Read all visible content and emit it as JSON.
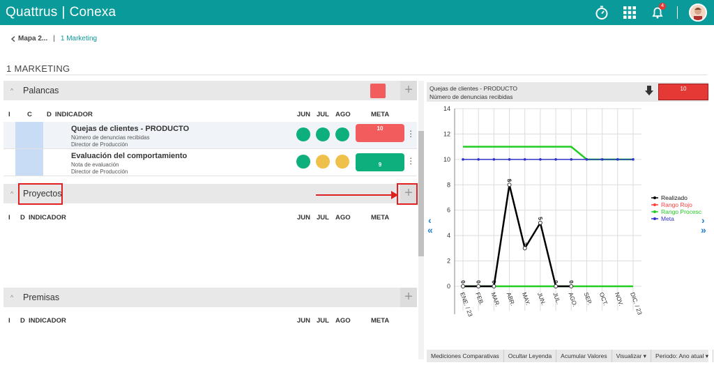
{
  "app": {
    "brand_left": "Quattrus",
    "brand_sep": "|",
    "brand_right": "Conexa",
    "notification_count": "4"
  },
  "breadcrumb": {
    "back_label": "Mapa 2...",
    "current": "1 Marketing"
  },
  "page": {
    "title": "1 MARKETING"
  },
  "palancas": {
    "label": "Palancas",
    "headers": {
      "i": "I",
      "c": "C",
      "d": "D",
      "indicador": "INDICADOR",
      "jun": "JUN",
      "jul": "JUL",
      "ago": "AGO",
      "meta": "META"
    },
    "rows": [
      {
        "name": "Quejas de clientes - PRODUCTO",
        "sub1": "Número de denuncias recibidas",
        "sub2": "Director de Producción",
        "jun": "green",
        "jul": "green",
        "ago": "green",
        "meta_value": "10",
        "meta_color": "red"
      },
      {
        "name": "Evaluación del comportamiento",
        "sub1": "Nota de evaluación",
        "sub2": "Director de Producción",
        "jun": "green",
        "jul": "yellow",
        "ago": "yellow",
        "meta_value": "9",
        "meta_color": "green"
      }
    ]
  },
  "proyectos": {
    "label": "Proyectos",
    "headers": {
      "i": "I",
      "d": "D",
      "indicador": "INDICADOR",
      "jun": "JUN",
      "jul": "JUL",
      "ago": "AGO",
      "meta": "META"
    }
  },
  "premisas": {
    "label": "Premisas",
    "headers": {
      "i": "I",
      "d": "D",
      "indicador": "INDICADOR",
      "jun": "JUN",
      "jul": "JUL",
      "ago": "AGO",
      "meta": "META"
    }
  },
  "chart_panel": {
    "title_line1": "Quejas de clientes - PRODUCTO",
    "title_line2": "Número de denuncias recibidas",
    "value_badge": "10"
  },
  "chart_data": {
    "type": "line",
    "title": "",
    "xlabel": "",
    "ylabel": "",
    "categories": [
      "ENE. / 23",
      "FEB.",
      "MAR.",
      "ABR.",
      "MAY.",
      "JUN.",
      "JUL.",
      "AGO.",
      "SEP.",
      "OCT.",
      "NOV.",
      "DIC. / 23"
    ],
    "ylim": [
      0,
      14
    ],
    "yticks": [
      0,
      2,
      4,
      6,
      8,
      10,
      12,
      14
    ],
    "grid": true,
    "legend_position": "right",
    "series": [
      {
        "name": "Realizado",
        "color": "#000000",
        "values": [
          0,
          0,
          0,
          8,
          3,
          5,
          0,
          0,
          null,
          null,
          null,
          null
        ],
        "labels": [
          "0",
          "0",
          "0",
          "8",
          "3",
          "5",
          "0",
          "0"
        ]
      },
      {
        "name": "Rango Rojo",
        "color": "#ff3b3b",
        "values": []
      },
      {
        "name": "Rango Proceso",
        "legend_text": "Rango Procesc",
        "color": "#22cc22",
        "values": [
          11,
          11,
          11,
          11,
          11,
          11,
          11,
          11,
          10,
          10,
          10,
          10
        ],
        "values_low": [
          0,
          0,
          0,
          0,
          0,
          0,
          0,
          0,
          0,
          0,
          0,
          0
        ]
      },
      {
        "name": "Meta",
        "color": "#3333cc",
        "values": [
          10,
          10,
          10,
          10,
          10,
          10,
          10,
          10,
          10,
          10,
          10,
          10
        ]
      }
    ]
  },
  "bottom_bar": {
    "comparativas": "Mediciones Comparativas",
    "ocultar": "Ocultar Leyenda",
    "acumular": "Acumular Valores",
    "visualizar": "Visualizar ▾",
    "periodo": "Periodo: Ano atual ▾",
    "more": "»"
  },
  "colors": {
    "brand": "#0b9a9a",
    "red": "#f25c5c",
    "green": "#0db07c",
    "yellow": "#efc14a"
  }
}
